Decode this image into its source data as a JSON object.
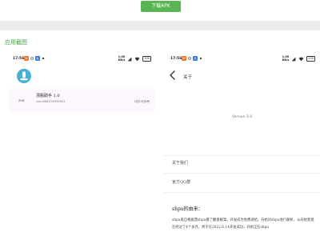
{
  "page": {
    "download_label": "下载APK",
    "screenshots_title": "应用截图"
  },
  "statusbar": {
    "time": "17:56",
    "badge1": "✉",
    "badge2": "九",
    "net_speed": "1.00",
    "net_unit": "KB/s",
    "battery": "100"
  },
  "left_screen": {
    "row": {
      "thumb_text": "ZHB",
      "title": "漂瓶助手 1.0",
      "subtitle": "com/96613/9990052",
      "date": "2月23日8号"
    }
  },
  "right_screen": {
    "title": "关于",
    "version": "Version 3.0",
    "menu": [
      {
        "label": "关于我们"
      },
      {
        "label": "官方QQ群"
      }
    ],
    "intro_title": "shpu的由来：",
    "intro_body": "shpu来自根据漂shpu看了翻盘解案，开发成为免费递给，开始对shpu进行解析，从开始到现在经过了4个多月，终于在2022.6.14开发成功，开始正在shpu"
  },
  "colors": {
    "brand_green": "#58b552",
    "title_green": "#43a047",
    "app_icon": "#48b0d6",
    "row_bg": "#fcf6ff"
  }
}
